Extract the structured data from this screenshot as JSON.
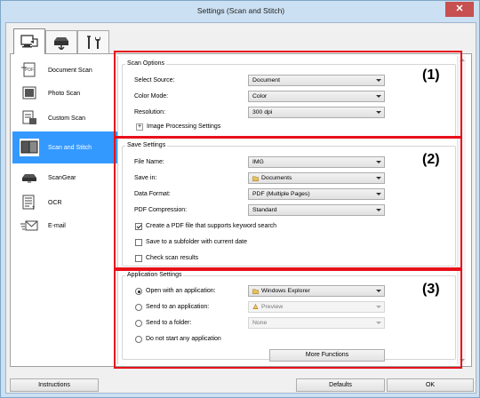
{
  "window": {
    "title": "Settings (Scan and Stitch)",
    "close_glyph": "✕"
  },
  "tabs": [
    {
      "icon": "scan-computer-icon",
      "active": true
    },
    {
      "icon": "scanner-icon",
      "active": false
    },
    {
      "icon": "tools-icon",
      "active": false
    }
  ],
  "sidebar": {
    "items": [
      {
        "label": "Document Scan",
        "icon": "document-scan-icon",
        "selected": false
      },
      {
        "label": "Photo Scan",
        "icon": "photo-scan-icon",
        "selected": false
      },
      {
        "label": "Custom Scan",
        "icon": "custom-scan-icon",
        "selected": false
      },
      {
        "label": "Scan and Stitch",
        "icon": "scan-stitch-icon",
        "selected": true
      },
      {
        "label": "ScanGear",
        "icon": "scangear-icon",
        "selected": false
      },
      {
        "label": "OCR",
        "icon": "ocr-icon",
        "selected": false
      },
      {
        "label": "E-mail",
        "icon": "email-icon",
        "selected": false
      }
    ]
  },
  "scan_options": {
    "title": "Scan Options",
    "source_label": "Select Source:",
    "source_value": "Document",
    "color_label": "Color Mode:",
    "color_value": "Color",
    "resolution_label": "Resolution:",
    "resolution_value": "300 dpi",
    "image_processing_label": "Image Processing Settings",
    "expand_glyph": "+"
  },
  "save_settings": {
    "title": "Save Settings",
    "file_name_label": "File Name:",
    "file_name_value": "IMG",
    "save_in_label": "Save in:",
    "save_in_value": "Documents",
    "data_format_label": "Data Format:",
    "data_format_value": "PDF (Multiple Pages)",
    "pdf_compression_label": "PDF Compression:",
    "pdf_compression_value": "Standard",
    "keyword_label": "Create a PDF file that supports keyword search",
    "keyword_checked": true,
    "subfolder_label": "Save to a subfolder with current date",
    "subfolder_checked": false,
    "check_results_label": "Check scan results",
    "check_results_checked": false
  },
  "app_settings": {
    "title": "Application Settings",
    "open_app_label": "Open with an application:",
    "open_app_value": "Windows Explorer",
    "send_app_label": "Send to an application:",
    "send_app_value": "Preview",
    "send_folder_label": "Send to a folder:",
    "send_folder_value": "None",
    "no_app_label": "Do not start any application",
    "more_functions_label": "More Functions",
    "selected_option": "open_app"
  },
  "annotations": {
    "section1": "(1)",
    "section2": "(2)",
    "section3": "(3)",
    "color": "#e8101a"
  },
  "footer": {
    "instructions_label": "Instructions",
    "defaults_label": "Defaults",
    "ok_label": "OK"
  }
}
